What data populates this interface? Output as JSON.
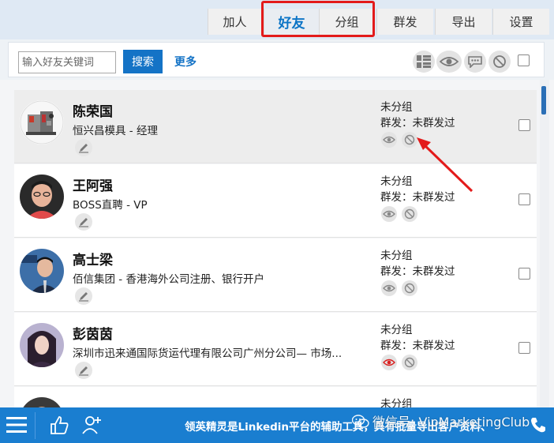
{
  "tabs": [
    {
      "label": "加人",
      "active": false
    },
    {
      "label": "好友",
      "active": true
    },
    {
      "label": "分组",
      "active": false
    },
    {
      "label": "群发",
      "active": false
    },
    {
      "label": "导出",
      "active": false
    },
    {
      "label": "设置",
      "active": false
    }
  ],
  "toolbar": {
    "search_placeholder": "输入好友关键词",
    "search_label": "搜索",
    "more_label": "更多",
    "icons": [
      "grid-view-icon",
      "eye-icon",
      "chat-bubble-icon",
      "block-icon"
    ]
  },
  "contacts": [
    {
      "name": "陈荣国",
      "company": "恒兴昌模具 - 经理",
      "group": "未分组",
      "bulk": "群发：未群发过",
      "highlighted": true,
      "eye_active": false
    },
    {
      "name": "王阿强",
      "company": "BOSS直聘 - VP",
      "group": "未分组",
      "bulk": "群发：未群发过",
      "highlighted": false,
      "eye_active": false
    },
    {
      "name": "高士梁",
      "company": "佰信集团 - 香港海外公司注册、银行开户",
      "group": "未分组",
      "bulk": "群发：未群发过",
      "highlighted": false,
      "eye_active": false
    },
    {
      "name": "彭茵茵",
      "company": "深圳市迅来通国际货运代理有限公司广州分公司— 市场...",
      "group": "未分组",
      "bulk": "群发：未群发过",
      "highlighted": false,
      "eye_active": true
    },
    {
      "name": "",
      "company": "",
      "group": "未分组",
      "bulk": "",
      "highlighted": false,
      "eye_active": false
    }
  ],
  "bottom_bar": {
    "marquee": "领英精灵是Linkedin平台的辅助工具，具有批量导出客户资料、",
    "watermark": "微信号: VipMarketingClub"
  },
  "colors": {
    "accent": "#1473c6",
    "bottom_bar": "#1a7ed0",
    "annotation": "#e31b1b",
    "eye_active": "#d9201f"
  }
}
